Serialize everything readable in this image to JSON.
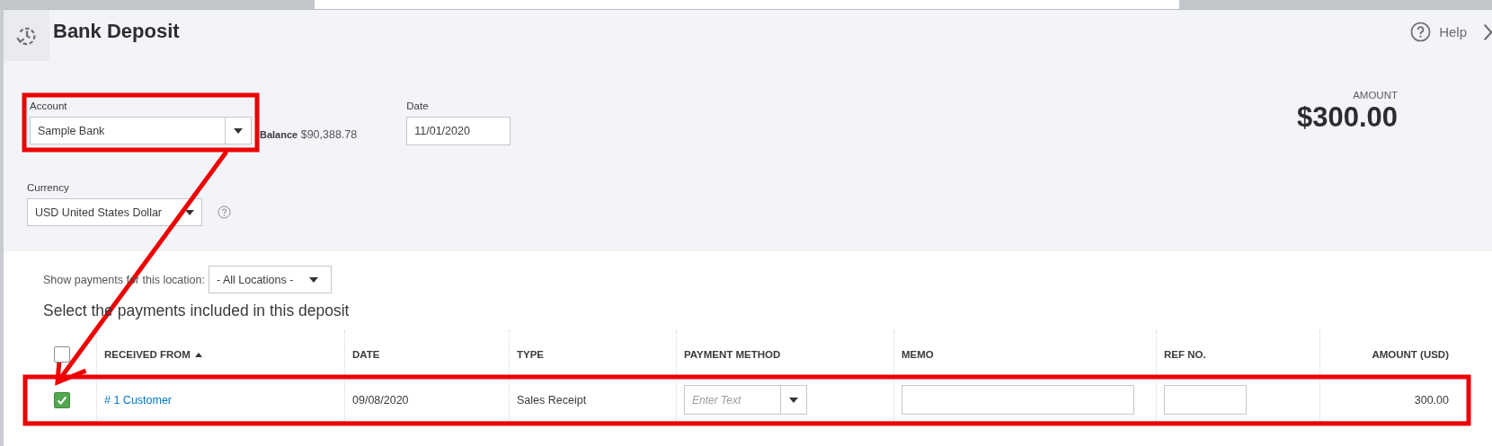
{
  "header": {
    "title": "Bank Deposit",
    "help": "Help"
  },
  "account": {
    "label": "Account",
    "value": "Sample Bank"
  },
  "balance": {
    "label": "Balance",
    "value": "$90,388.78"
  },
  "date": {
    "label": "Date",
    "value": "11/01/2020"
  },
  "amount": {
    "label": "AMOUNT",
    "value": "$300.00"
  },
  "currency": {
    "label": "Currency",
    "value": "USD United States Dollar"
  },
  "location_filter": {
    "label": "Show payments for this location:",
    "value": "- All Locations -"
  },
  "section_title": "Select the payments included in this deposit",
  "table": {
    "select_all_checked": false,
    "columns": [
      {
        "label": "RECEIVED FROM",
        "sorted": true
      },
      {
        "label": "DATE",
        "sorted": false
      },
      {
        "label": "TYPE",
        "sorted": false
      },
      {
        "label": "PAYMENT METHOD",
        "sorted": false
      },
      {
        "label": "MEMO",
        "sorted": false
      },
      {
        "label": "REF NO.",
        "sorted": false
      },
      {
        "label": "AMOUNT (USD)",
        "sorted": false
      }
    ],
    "rows": [
      {
        "checked": true,
        "received_from": "# 1 Customer",
        "date": "09/08/2020",
        "type": "Sales Receipt",
        "payment_method": {
          "placeholder": "Enter Text"
        },
        "amount": "300.00"
      }
    ]
  },
  "annotations": [
    {
      "kind": "box"
    },
    {
      "kind": "arrow"
    },
    {
      "kind": "box"
    }
  ]
}
